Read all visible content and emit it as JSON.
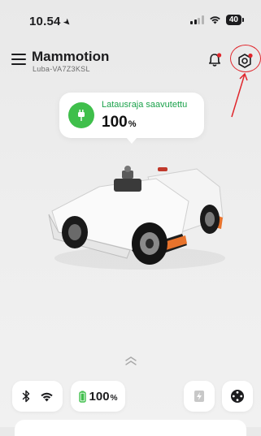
{
  "status_bar": {
    "time": "10.54",
    "battery": "40"
  },
  "header": {
    "title": "Mammotion",
    "subtitle": "Luba-VA7Z3KSL"
  },
  "charge_callout": {
    "label": "Latausraja saavutettu",
    "value": "100",
    "unit": "%"
  },
  "bottom_bar": {
    "battery_value": "100",
    "battery_unit": "%"
  },
  "colors": {
    "accent_green": "#3fbf4b",
    "notification_red": "#e0262c",
    "annotation_red": "#e0262c"
  },
  "icons": [
    "menu-icon",
    "bell-icon",
    "gear-icon",
    "plug-icon",
    "bluetooth-icon",
    "wifi-icon",
    "battery-icon",
    "charge-station-icon",
    "joystick-icon",
    "chevron-up-icon"
  ]
}
